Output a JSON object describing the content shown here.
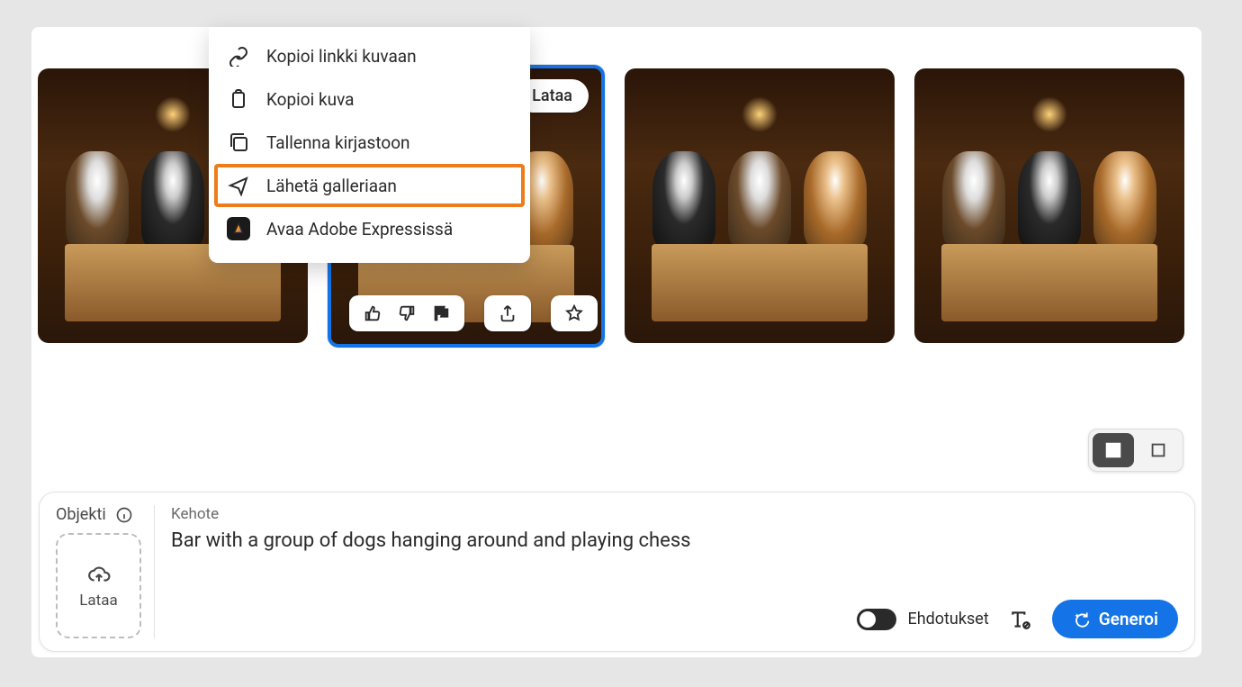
{
  "gallery": {
    "download_label": "Lataa"
  },
  "context_menu": {
    "items": [
      {
        "label": "Kopioi linkki kuvaan"
      },
      {
        "label": "Kopioi kuva"
      },
      {
        "label": "Tallenna kirjastoon"
      },
      {
        "label": "Lähetä galleriaan"
      },
      {
        "label": "Avaa Adobe Expressissä"
      }
    ]
  },
  "prompt_bar": {
    "object_label": "Objekti",
    "upload_label": "Lataa",
    "prompt_label": "Kehote",
    "prompt_text": "Bar with a group of dogs hanging around and playing chess",
    "suggestions_label": "Ehdotukset",
    "generate_label": "Generoi"
  }
}
